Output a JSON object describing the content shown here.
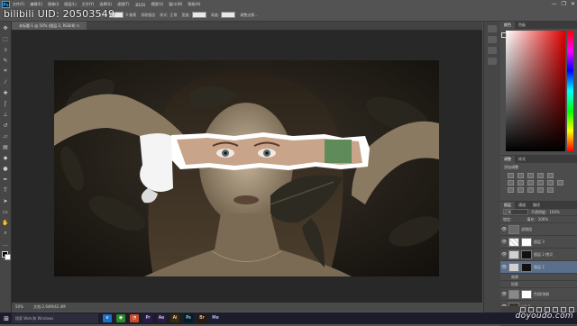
{
  "app": {
    "logo": "Ps"
  },
  "menubar": {
    "items": [
      "文件(F)",
      "编辑(E)",
      "图像(I)",
      "图层(L)",
      "文字(Y)",
      "选择(S)",
      "滤镜(T)",
      "3D(D)",
      "视图(V)",
      "窗口(W)",
      "帮助(H)"
    ],
    "window_buttons": [
      "—",
      "❐",
      "✕"
    ]
  },
  "options_bar": {
    "items": [
      "羽化:",
      "0 像素",
      "消除锯齿",
      "样式:",
      "正常",
      "宽度:",
      "高度:",
      "调整边缘..."
    ]
  },
  "watermark": {
    "text": "bilibili UID: 20503549"
  },
  "document": {
    "tab_label": "未标题-1 @ 50% (图层 2, RGB/8) ×",
    "status_zoom": "50%",
    "status_info": "文档:2.64M/42.4M"
  },
  "tools": [
    "move",
    "marquee",
    "lasso",
    "quick-select",
    "crop",
    "eyedropper",
    "healing",
    "brush",
    "stamp",
    "history-brush",
    "eraser",
    "gradient",
    "blur",
    "dodge",
    "pen",
    "type",
    "path-select",
    "shape",
    "hand",
    "zoom",
    "more",
    "fg-bg-color"
  ],
  "panels": {
    "color_tabs": [
      "颜色",
      "色板"
    ],
    "adjust_tabs": [
      "调整",
      "样式"
    ],
    "adjust_label": "添加调整",
    "layers_tabs": [
      "图层",
      "通道",
      "路径"
    ],
    "blend_mode": "正常",
    "opacity_label": "不透明度:",
    "opacity_value": "100%",
    "lock_label": "锁定:",
    "fill_label": "填充:",
    "fill_value": "100%",
    "layers": [
      {
        "name": "滤镜组",
        "type": "group",
        "selected": false
      },
      {
        "name": "图层 3",
        "type": "layer",
        "selected": false
      },
      {
        "name": "图层 2 拷贝",
        "type": "layer",
        "selected": false
      },
      {
        "name": "图层 2",
        "type": "layer",
        "selected": true
      },
      {
        "name": "效果",
        "type": "sub",
        "selected": false
      },
      {
        "name": "投影",
        "type": "sub",
        "selected": false
      },
      {
        "name": "色相/饱和",
        "type": "layer",
        "selected": false
      },
      {
        "name": "girl-1",
        "type": "layer",
        "selected": false
      },
      {
        "name": "girl-2",
        "type": "layer",
        "selected": false
      }
    ]
  },
  "taskbar": {
    "search_placeholder": "搜索 Web 和 Windows",
    "apps": [
      {
        "label": "e",
        "color": "#1e6ec8"
      },
      {
        "label": "◉",
        "color": "#2a8a2a"
      },
      {
        "label": "◔",
        "color": "#c94a2a"
      },
      {
        "label": "Pr",
        "color": "#2a1a4a"
      },
      {
        "label": "Ae",
        "color": "#2a1a4a"
      },
      {
        "label": "Ai",
        "color": "#3a2a0a"
      },
      {
        "label": "Ps",
        "color": "#001d2a"
      },
      {
        "label": "Br",
        "color": "#2a1a0a"
      },
      {
        "label": "Me",
        "color": "#1a1a3a"
      }
    ]
  },
  "site_watermark": {
    "text": "doyoudo.com"
  }
}
